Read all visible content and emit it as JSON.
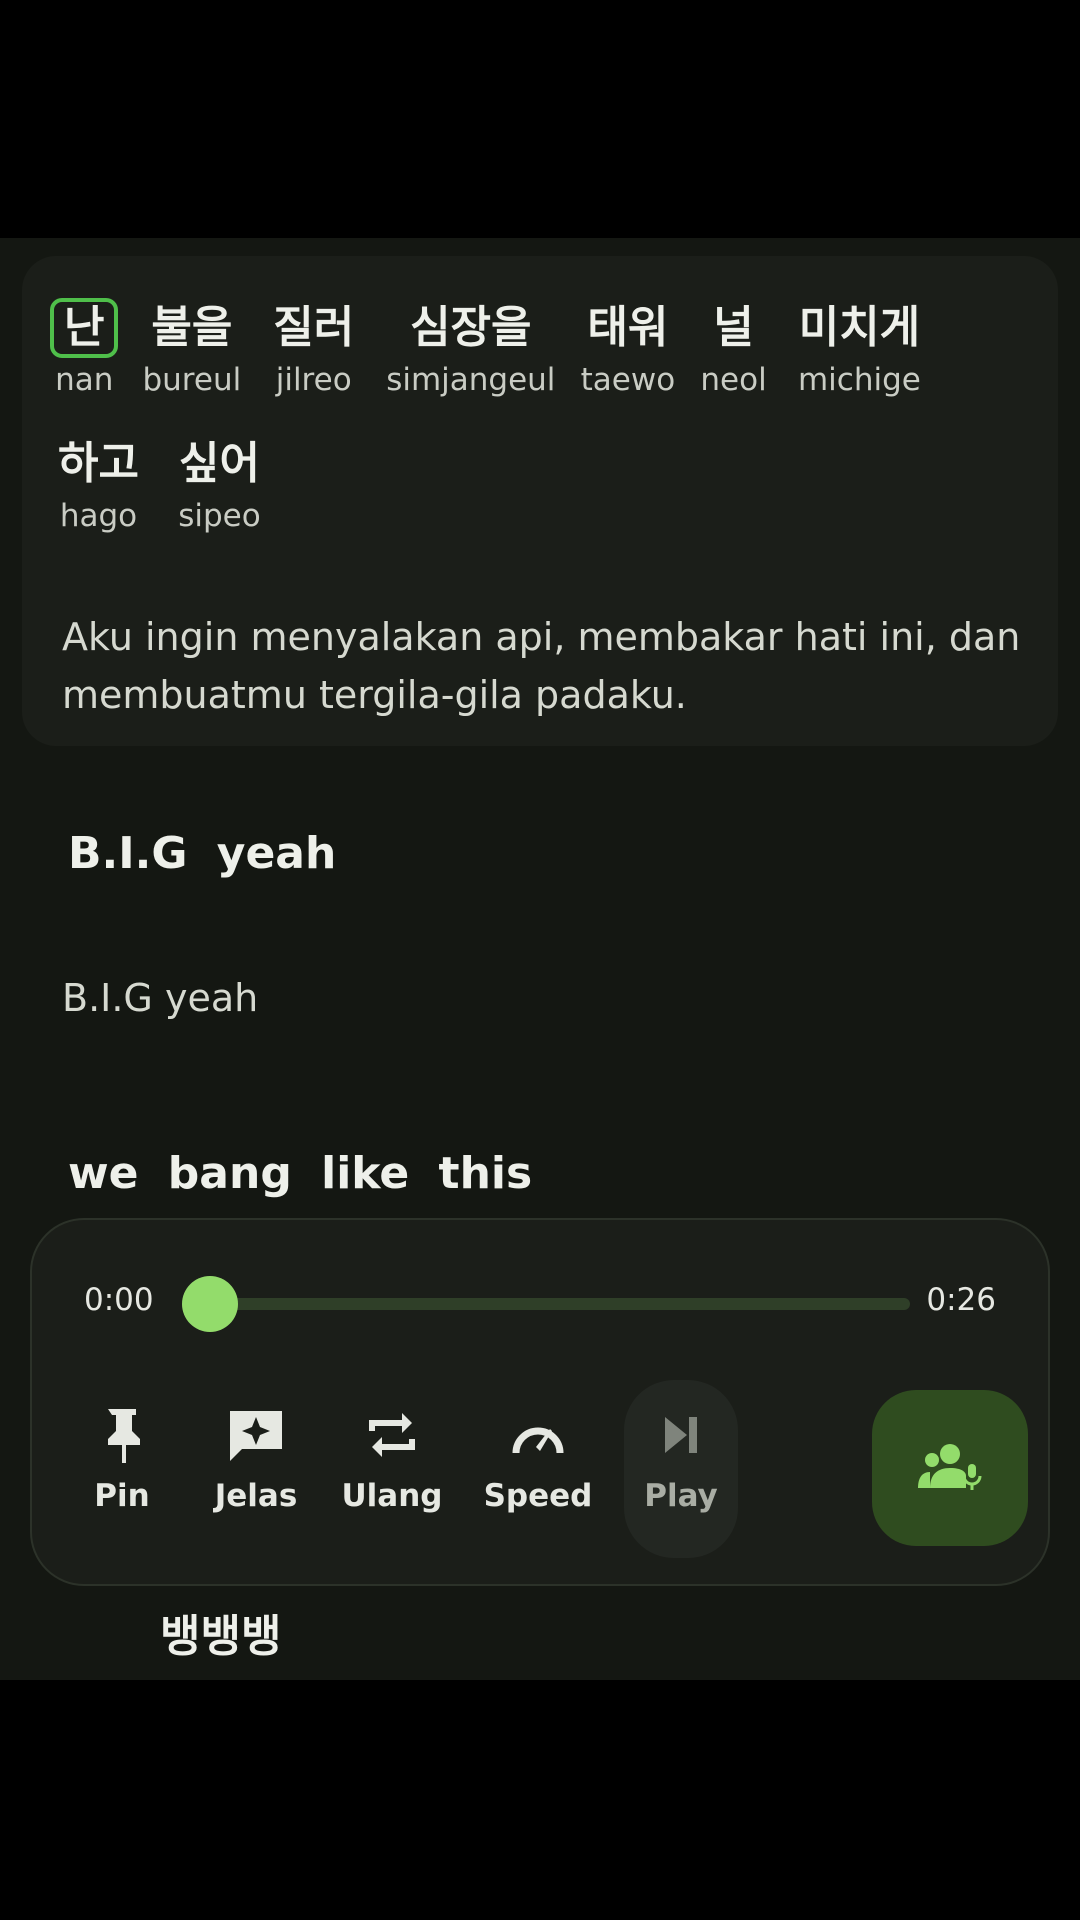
{
  "lyric_card": {
    "row1": [
      {
        "kr": "난",
        "rom": "nan"
      },
      {
        "kr": "불을",
        "rom": "bureul"
      },
      {
        "kr": "질러",
        "rom": "jilreo"
      },
      {
        "kr": "심장을",
        "rom": "simjangeul"
      },
      {
        "kr": "태워",
        "rom": "taewo"
      },
      {
        "kr": "널",
        "rom": "neol"
      },
      {
        "kr": "미치게",
        "rom": "michige"
      }
    ],
    "row2": [
      {
        "kr": "하고",
        "rom": "hago"
      },
      {
        "kr": "싶어",
        "rom": "sipeo"
      }
    ],
    "translation": "Aku ingin menyalakan api, membakar hati ini, dan membuatmu tergila-gila padaku."
  },
  "lines": {
    "line2_original": "B.I.G yeah",
    "line2_translation": "B.I.G yeah",
    "line3_original": "we bang like this",
    "line4_word": "뱅뱅뱅"
  },
  "player": {
    "time_start": "0:00",
    "time_end": "0:26",
    "progress": 0.0,
    "controls": {
      "pin": "Pin",
      "explain": "Jelas",
      "repeat": "Ulang",
      "speed": "Speed",
      "play": "Play"
    },
    "accent_color": "#93dc6b",
    "icons": [
      "pin-icon",
      "sparkle-chat-icon",
      "repeat-icon",
      "speedometer-icon",
      "play-pause-icon",
      "voice-users-icon"
    ]
  }
}
